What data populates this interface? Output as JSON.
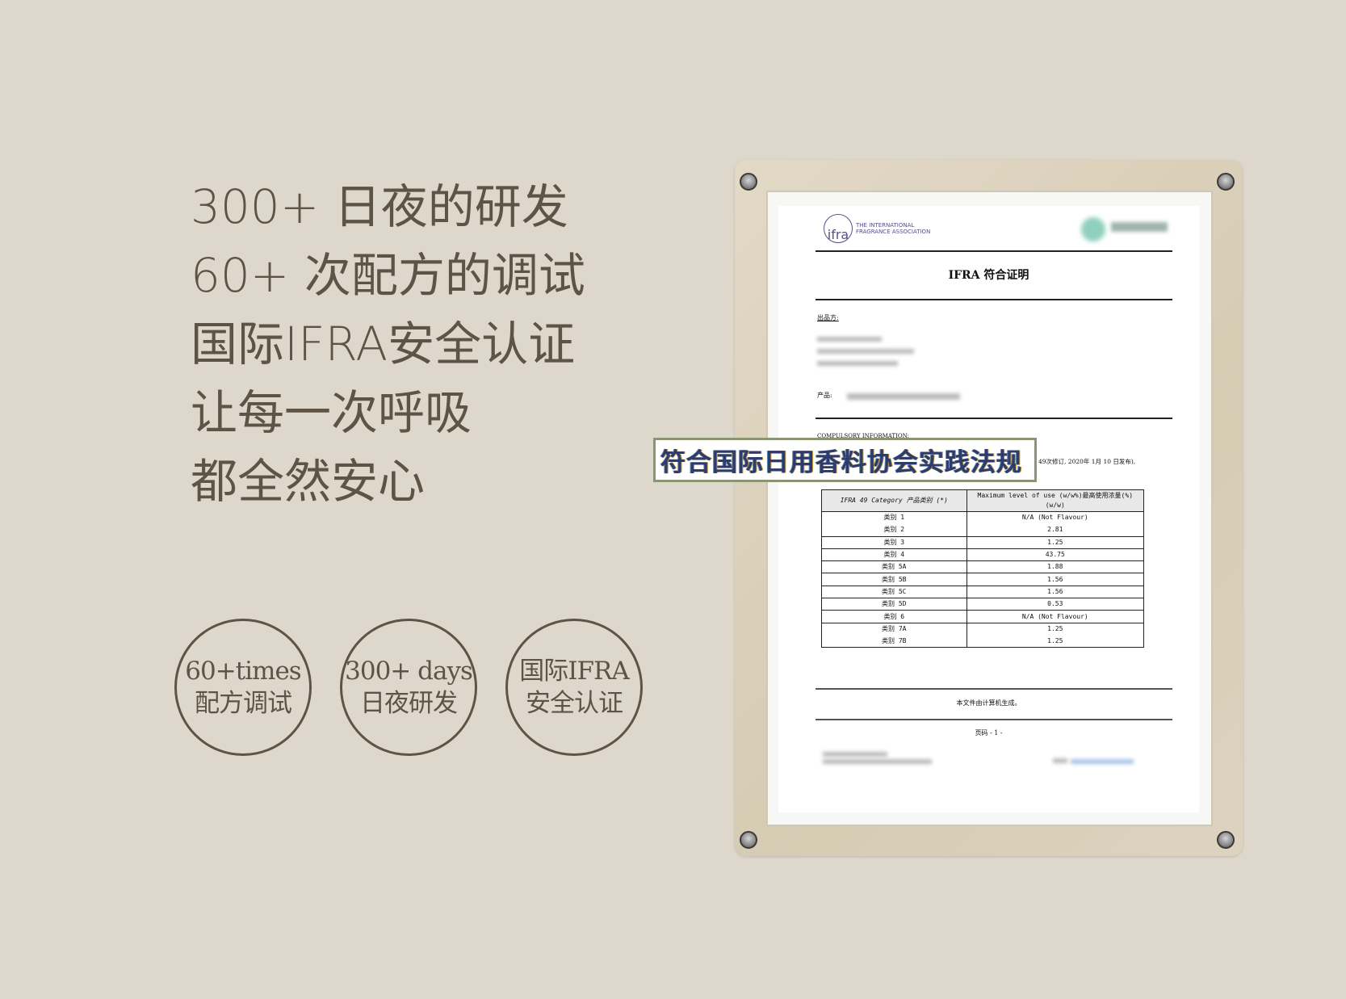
{
  "headline": [
    "300+ 日夜的研发",
    "60+ 次配方的调试",
    "国际IFRA安全认证",
    "让每一次呼吸",
    "都全然安心"
  ],
  "badges": [
    {
      "line1": "60+times",
      "line2": "配方调试"
    },
    {
      "line1": "300+ days",
      "line2": "日夜研发"
    },
    {
      "line1": "国际IFRA",
      "line2": "安全认证"
    }
  ],
  "certificate": {
    "logo_mark": "ifra",
    "logo_text_1": "THE INTERNATIONAL",
    "logo_text_2": "FRAGRANCE ASSOCIATION",
    "title": "IFRA 符合证明",
    "issuer_label": "出品方:",
    "product_label": "产品:",
    "compulsory": "COMPULSORY INFORMATION:",
    "amendment": "49次修订, 2020年 1月 10 日发布),",
    "banner": "符合国际日用香料协会实践法规",
    "table_headers": [
      "IFRA  49 Category 产品类别 (*)",
      "Maximum level of use (w/w%)最高使用浓量(%) (w/w)"
    ],
    "rows": [
      [
        "类别 1",
        "N/A (Not Flavour)"
      ],
      [
        "类别 2",
        "2.81"
      ],
      [
        "类别 3",
        "1.25"
      ],
      [
        "类别 4",
        "43.75"
      ],
      [
        "类别 5A",
        "1.88"
      ],
      [
        "类别 5B",
        "1.56"
      ],
      [
        "类别 5C",
        "1.56"
      ],
      [
        "类别 5D",
        "0.53"
      ],
      [
        "类别 6",
        "N/A (Not Flavour)"
      ],
      [
        "类别 7A",
        "1.25"
      ],
      [
        "类别 7B",
        "1.25"
      ]
    ],
    "generated": "本文件由计算机生成。",
    "page": "页码 - 1 -"
  }
}
